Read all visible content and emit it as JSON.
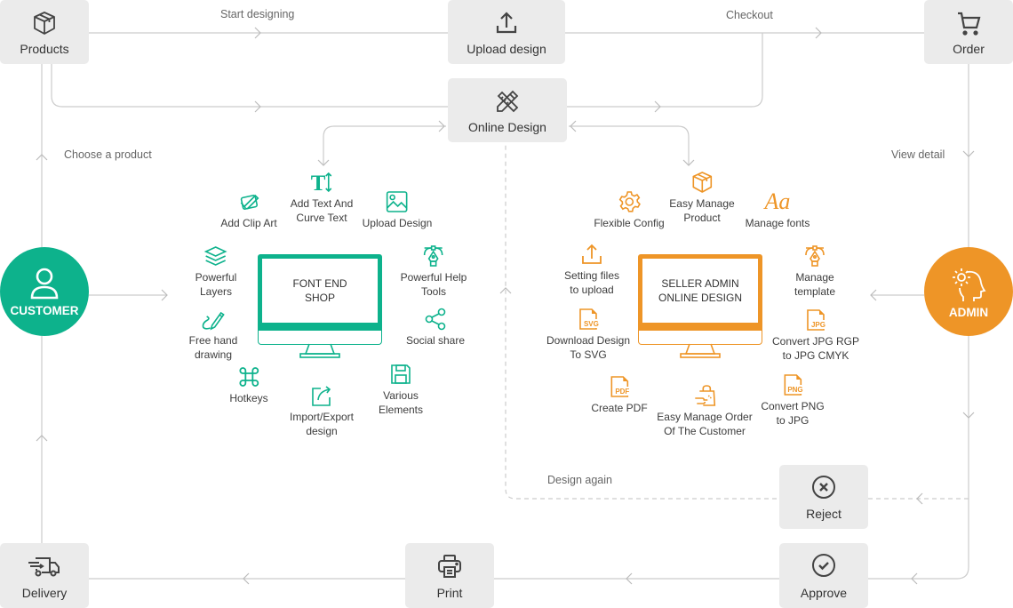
{
  "colors": {
    "customer": "#0db28c",
    "admin": "#ee9527",
    "node_bg": "#ebebeb",
    "line": "#cccccc"
  },
  "nodes": {
    "products": {
      "label": "Products",
      "icon": "box-icon"
    },
    "upload_design": {
      "label": "Upload design",
      "icon": "upload-icon"
    },
    "order": {
      "label": "Order",
      "icon": "cart-icon"
    },
    "online_design": {
      "label": "Online Design",
      "icon": "pencil-ruler-icon"
    },
    "reject": {
      "label": "Reject",
      "icon": "close-circle-icon"
    },
    "approve": {
      "label": "Approve",
      "icon": "check-circle-icon"
    },
    "print": {
      "label": "Print",
      "icon": "printer-icon"
    },
    "delivery": {
      "label": "Delivery",
      "icon": "truck-icon"
    }
  },
  "flow_labels": {
    "start_designing": "Start designing",
    "checkout": "Checkout",
    "choose_product": "Choose a product",
    "view_detail": "View detail",
    "design_again": "Design again"
  },
  "roles": {
    "customer": {
      "label": "CUSTOMER",
      "icon": "user-icon"
    },
    "admin": {
      "label": "ADMIN",
      "icon": "head-gear-icon"
    }
  },
  "customer_shop": {
    "screen_title": [
      "FONT END",
      "SHOP"
    ],
    "features": [
      {
        "lines": [
          "Add Clip Art"
        ],
        "icon": "clip-art-icon"
      },
      {
        "lines": [
          "Add Text And",
          "Curve Text"
        ],
        "icon": "text-icon"
      },
      {
        "lines": [
          "Upload Design"
        ],
        "icon": "image-icon"
      },
      {
        "lines": [
          "Powerful",
          "Layers"
        ],
        "icon": "layers-icon"
      },
      {
        "lines": [
          "Powerful Help",
          "Tools"
        ],
        "icon": "pen-tool-icon"
      },
      {
        "lines": [
          "Free hand",
          "drawing"
        ],
        "icon": "pencil-icon"
      },
      {
        "lines": [
          "Social share"
        ],
        "icon": "share-icon"
      },
      {
        "lines": [
          "Hotkeys"
        ],
        "icon": "command-icon"
      },
      {
        "lines": [
          "Import/Export",
          "design"
        ],
        "icon": "export-icon"
      },
      {
        "lines": [
          "Various",
          "Elements"
        ],
        "icon": "save-icon"
      }
    ]
  },
  "admin_shop": {
    "screen_title": [
      "SELLER ADMIN",
      "ONLINE DESIGN"
    ],
    "features": [
      {
        "lines": [
          "Flexible Config"
        ],
        "icon": "gear-icon"
      },
      {
        "lines": [
          "Easy Manage",
          "Product"
        ],
        "icon": "box-icon"
      },
      {
        "lines": [
          "Manage fonts"
        ],
        "icon": "font-icon",
        "glyph": "Aa"
      },
      {
        "lines": [
          "Setting files",
          "to upload"
        ],
        "icon": "upload-icon"
      },
      {
        "lines": [
          "Manage",
          "template"
        ],
        "icon": "pen-tool-icon"
      },
      {
        "lines": [
          "Download Design",
          "To SVG"
        ],
        "icon": "svg-file-icon",
        "glyph": "SVG"
      },
      {
        "lines": [
          "Convert JPG RGP",
          "to JPG CMYK"
        ],
        "icon": "jpg-file-icon",
        "glyph": "JPG"
      },
      {
        "lines": [
          "Create PDF"
        ],
        "icon": "pdf-file-icon",
        "glyph": "PDF"
      },
      {
        "lines": [
          "Easy Manage Order",
          "Of The Customer"
        ],
        "icon": "shopping-bag-icon"
      },
      {
        "lines": [
          "Convert PNG",
          "to JPG"
        ],
        "icon": "png-file-icon",
        "glyph": "PNG"
      }
    ]
  }
}
